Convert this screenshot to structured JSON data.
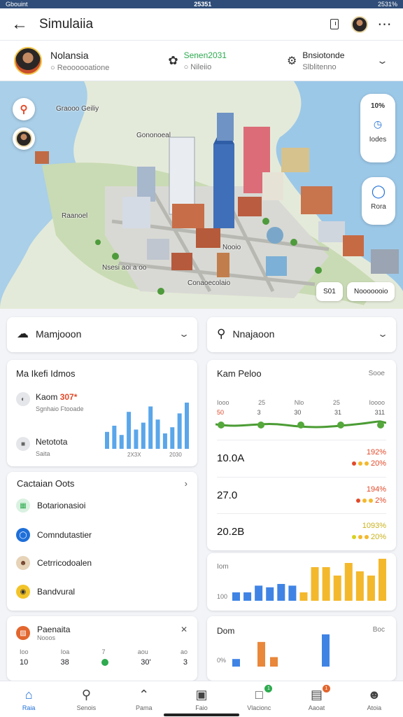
{
  "status_bar": {
    "left": "Gbouint",
    "center": "25351",
    "right": "2531%"
  },
  "header": {
    "title": "Simulaiia"
  },
  "profile": {
    "name": "Nolansia",
    "subtitle": "Reoooooatione",
    "center_title": "Senen2031",
    "center_sub": "Nileiio",
    "right_title": "Bnsiotonde",
    "right_sub": "Slblitenno"
  },
  "map": {
    "labels": [
      "Graooo Geiliy",
      "Gononoeal",
      "Raanoel",
      "Nooio",
      "Nsesi aoi a oo",
      "Conaoecolaio"
    ],
    "side_top": {
      "value": "10%",
      "label": "Iodes"
    },
    "side_bottom": {
      "label": "Rora"
    },
    "chip_left": "S01",
    "chip_right": "Nooooooio"
  },
  "left_dropdown": {
    "label": "Mamjooon"
  },
  "right_dropdown": {
    "label": "Nnajaoon"
  },
  "market_card": {
    "title": "Ma Ikefi Idmos",
    "row1_label": "Kaom",
    "row1_value": "307*",
    "row1_sub": "Sgnhaio Ftooade",
    "row2_label": "Netotota",
    "row2_sub": "Saita",
    "axis_labels": [
      "2X3X",
      "2030"
    ]
  },
  "content_card": {
    "title": "Cactaian Oots",
    "items": [
      {
        "label": "Botarionasioi",
        "icon": "grid-icon"
      },
      {
        "label": "Comndutastier",
        "icon": "circle-icon"
      },
      {
        "label": "Cetrricodoalen",
        "icon": "person-icon"
      },
      {
        "label": "Bandvural",
        "icon": "toggle-icon"
      }
    ]
  },
  "bottom_left_card": {
    "title": "Paenaita",
    "sub": "Nooos",
    "top_labels": [
      "Ioo",
      "Ioa",
      "7",
      "aou",
      "ao"
    ],
    "values": [
      "10",
      "38",
      "",
      "30'",
      "3"
    ]
  },
  "kpi_card": {
    "title": "Kam Peloo",
    "corner": "Sooe",
    "tick_labels": [
      "Iooo",
      "25",
      "Nlo",
      "25",
      "Ioooo"
    ],
    "tick_values": [
      "50",
      "3",
      "30",
      "31",
      "311"
    ],
    "rows": [
      {
        "value": "10.0A",
        "pct1": "192%",
        "pct2": "20%"
      },
      {
        "value": "27.0",
        "pct1": "194%",
        "pct2": "2%"
      },
      {
        "value": "20.2B",
        "pct1": "1093%",
        "pct2": "20%"
      }
    ]
  },
  "bar_card": {
    "y_top": "Iom",
    "y_bottom": "100"
  },
  "bottom_right_card": {
    "title": "Dom",
    "corner": "Boc",
    "axis_label": "0%"
  },
  "chart_data": [
    {
      "type": "bar",
      "values": [
        22,
        30,
        18,
        48,
        25,
        34,
        55,
        38,
        20,
        28,
        46,
        60
      ]
    },
    {
      "type": "line",
      "values": [
        50,
        3,
        30,
        31,
        311
      ]
    },
    {
      "type": "bar",
      "values": [
        10,
        10,
        18,
        16,
        20,
        18,
        10,
        40,
        40,
        30,
        45,
        35,
        30,
        50
      ]
    },
    {
      "type": "bar",
      "values": [
        8,
        26,
        10,
        34
      ]
    }
  ],
  "colors": {
    "accent": "#1e6fd9",
    "positive": "#2eaa4f",
    "negative": "#e24a2a",
    "warning": "#f3b82c"
  },
  "nav": [
    {
      "label": "Raia",
      "icon": "home-icon",
      "badge": ""
    },
    {
      "label": "Senois",
      "icon": "search-icon",
      "badge": ""
    },
    {
      "label": "Pama",
      "icon": "house-icon",
      "badge": ""
    },
    {
      "label": "Faio",
      "icon": "photo-icon",
      "badge": ""
    },
    {
      "label": "Vlacionc",
      "icon": "chat-icon",
      "badge": "1"
    },
    {
      "label": "Aaoat",
      "icon": "calendar-icon",
      "badge": "1"
    },
    {
      "label": "Atoia",
      "icon": "user-icon",
      "badge": ""
    }
  ]
}
